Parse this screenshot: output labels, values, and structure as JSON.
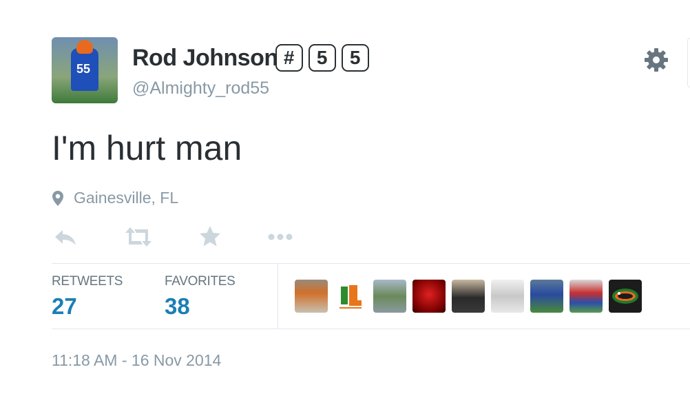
{
  "tweet": {
    "author": {
      "name": "Rod Johnson",
      "emoji_keys": [
        "#",
        "5",
        "5"
      ],
      "handle": "@Almighty_rod55",
      "avatar_jersey": "55"
    },
    "text": "I'm hurt man",
    "location": "Gainesville, FL",
    "actions": [
      {
        "name": "reply",
        "icon": "reply-icon"
      },
      {
        "name": "retweet",
        "icon": "retweet-icon"
      },
      {
        "name": "favorite",
        "icon": "star-icon"
      },
      {
        "name": "more",
        "icon": "more-icon"
      }
    ],
    "stats": {
      "retweets_label": "RETWEETS",
      "retweets_value": "27",
      "favorites_label": "FAVORITES",
      "favorites_value": "38"
    },
    "favoriters": [
      {
        "name": "favoriter-1",
        "color": "#c8702a"
      },
      {
        "name": "favoriter-2",
        "color": "#ffffff"
      },
      {
        "name": "favoriter-3",
        "color": "#7a9a6a"
      },
      {
        "name": "favoriter-4",
        "color": "#b01010"
      },
      {
        "name": "favoriter-5",
        "color": "#5a4a3a"
      },
      {
        "name": "favoriter-6",
        "color": "#e8e8e8"
      },
      {
        "name": "favoriter-7",
        "color": "#3a6a3a"
      },
      {
        "name": "favoriter-8",
        "color": "#c83a3a"
      },
      {
        "name": "favoriter-9",
        "color": "#1a1a1a"
      }
    ],
    "timestamp": "11:18 AM - 16 Nov 2014"
  },
  "colors": {
    "text": "#292f33",
    "muted": "#8899a6",
    "stat_value": "#1b7fb5",
    "divider": "#e1e8ed"
  }
}
